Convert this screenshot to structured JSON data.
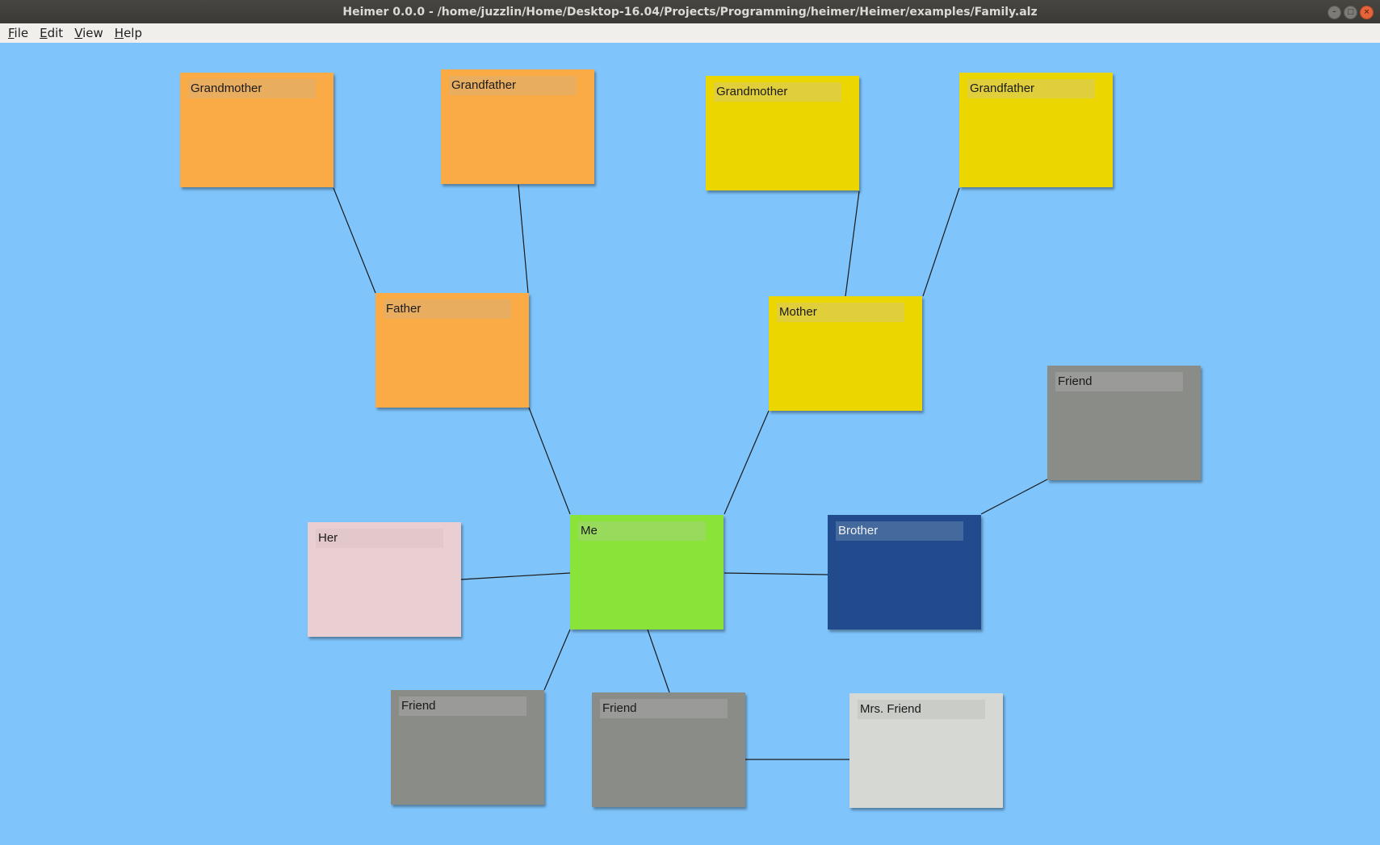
{
  "window": {
    "title": "Heimer 0.0.0 - /home/juzzlin/Home/Desktop-16.04/Projects/Programming/heimer/Heimer/examples/Family.alz",
    "controls": {
      "minimize": "–",
      "maximize": "□",
      "close": "×"
    }
  },
  "menubar": {
    "file": {
      "mnemonic": "F",
      "rest": "ile"
    },
    "edit": {
      "mnemonic": "E",
      "rest": "dit"
    },
    "view": {
      "mnemonic": "V",
      "rest": "iew"
    },
    "help": {
      "mnemonic": "H",
      "rest": "elp"
    }
  },
  "canvas": {
    "background": "#7fc5fc"
  },
  "nodes": {
    "grandmother_paternal": {
      "label": "Grandmother",
      "color": "#fbab45",
      "label_bg": "#e9ad60"
    },
    "grandfather_paternal": {
      "label": "Grandfather",
      "color": "#fbab45",
      "label_bg": "#e9ad60"
    },
    "grandmother_maternal": {
      "label": "Grandmother",
      "color": "#ecd600",
      "label_bg": "#e0cf3a"
    },
    "grandfather_maternal": {
      "label": "Grandfather",
      "color": "#ecd600",
      "label_bg": "#e0cf3a"
    },
    "father": {
      "label": "Father",
      "color": "#fbab45",
      "label_bg": "#e9ad60"
    },
    "mother": {
      "label": "Mother",
      "color": "#ecd600",
      "label_bg": "#e0cf3a"
    },
    "friend_right": {
      "label": "Friend",
      "color": "#8a8c88",
      "label_bg": "#9a9b98"
    },
    "her": {
      "label": "Her",
      "color": "#e9cfd2",
      "label_bg": "#e3c8cb"
    },
    "me": {
      "label": "Me",
      "color": "#89e338",
      "label_bg": "#98da5c"
    },
    "brother": {
      "label": "Brother",
      "color": "#214b8c",
      "label_bg": "#446a9d"
    },
    "friend_bottom_left": {
      "label": "Friend",
      "color": "#8a8c88",
      "label_bg": "#9a9b98"
    },
    "friend_bottom_middle": {
      "label": "Friend",
      "color": "#8a8c88",
      "label_bg": "#9a9b98"
    },
    "mrs_friend": {
      "label": "Mrs. Friend",
      "color": "#d5d8d3",
      "label_bg": "#c9ccc7"
    }
  }
}
